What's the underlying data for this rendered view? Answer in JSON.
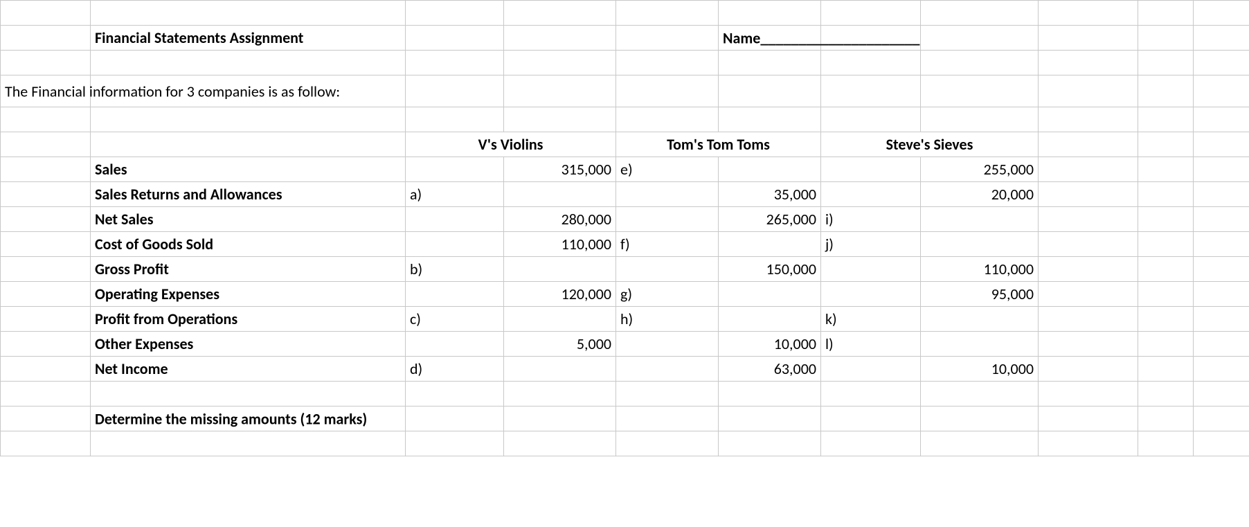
{
  "header": {
    "title": "Financial Statements Assignment",
    "name_label": "Name",
    "name_line": "_____________________"
  },
  "intro": "The Financial information for 3 companies is as follow:",
  "companies": {
    "c1": "V's Violins",
    "c2": "Tom's Tom Toms",
    "c3": "Steve's Sieves"
  },
  "rows": {
    "sales": {
      "label": "Sales",
      "v_l": "",
      "v_r": "315,000",
      "t_l": "e)",
      "t_r": "",
      "s_l": "",
      "s_r": "255,000"
    },
    "returns": {
      "label": "Sales Returns and Allowances",
      "v_l": "a)",
      "v_r": "",
      "t_l": "",
      "t_r": "35,000",
      "s_l": "",
      "s_r": "20,000"
    },
    "netsales": {
      "label": "Net Sales",
      "v_l": "",
      "v_r": "280,000",
      "t_l": "",
      "t_r": "265,000",
      "s_l": "i)",
      "s_r": ""
    },
    "cogs": {
      "label": "Cost of Goods Sold",
      "v_l": "",
      "v_r": "110,000",
      "t_l": "f)",
      "t_r": "",
      "s_l": "j)",
      "s_r": ""
    },
    "gross": {
      "label": "Gross Profit",
      "v_l": "b)",
      "v_r": "",
      "t_l": "",
      "t_r": "150,000",
      "s_l": "",
      "s_r": "110,000"
    },
    "opex": {
      "label": "Operating Expenses",
      "v_l": "",
      "v_r": "120,000",
      "t_l": "g)",
      "t_r": "",
      "s_l": "",
      "s_r": "95,000"
    },
    "opprofit": {
      "label": "Profit from Operations",
      "v_l": "c)",
      "v_r": "",
      "t_l": "h)",
      "t_r": "",
      "s_l": "k)",
      "s_r": ""
    },
    "otherex": {
      "label": "Other Expenses",
      "v_l": "",
      "v_r": "5,000",
      "t_l": "",
      "t_r": "10,000",
      "s_l": "l)",
      "s_r": ""
    },
    "netinc": {
      "label": "Net Income",
      "v_l": "d)",
      "v_r": "",
      "t_l": "",
      "t_r": "63,000",
      "s_l": "",
      "s_r": "10,000"
    }
  },
  "task": "Determine the missing amounts (12 marks)"
}
